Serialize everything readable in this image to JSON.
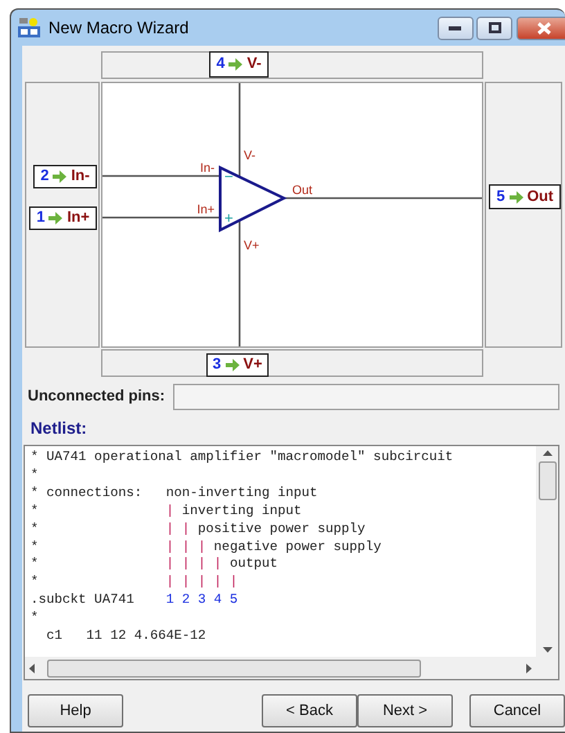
{
  "window": {
    "title": "New Macro Wizard"
  },
  "pins": [
    {
      "number": "4",
      "name": "V-",
      "kind": "top"
    },
    {
      "number": "2",
      "name": "In-",
      "kind": "inverting"
    },
    {
      "number": "1",
      "name": "In+",
      "kind": "noninverting"
    },
    {
      "number": "5",
      "name": "Out",
      "kind": "output"
    },
    {
      "number": "3",
      "name": "V+",
      "kind": "bottom"
    }
  ],
  "symbol": {
    "labels": [
      {
        "text": "V-",
        "kind": "top"
      },
      {
        "text": "In-",
        "kind": "inv"
      },
      {
        "text": "In+",
        "kind": "noninv"
      },
      {
        "text": "Out",
        "kind": "out"
      },
      {
        "text": "V+",
        "kind": "bottom"
      }
    ],
    "marks": [
      {
        "text": "−",
        "kind": "minus"
      },
      {
        "text": "+",
        "kind": "plus"
      }
    ]
  },
  "unconnected": {
    "label": "Unconnected pins:"
  },
  "netlist": {
    "label": "Netlist:",
    "lines": [
      [
        {
          "text": "* UA741 operational amplifier \"macromodel\" subcircuit",
          "kind": "plain"
        }
      ],
      [
        {
          "text": "*",
          "kind": "plain"
        }
      ],
      [
        {
          "text": "* connections:   non-inverting input",
          "kind": "plain"
        }
      ],
      [
        {
          "text": "*                ",
          "kind": "plain"
        },
        {
          "text": "|",
          "kind": "bar"
        },
        {
          "text": " inverting input",
          "kind": "plain"
        }
      ],
      [
        {
          "text": "*                ",
          "kind": "plain"
        },
        {
          "text": "| |",
          "kind": "bar"
        },
        {
          "text": " positive power supply",
          "kind": "plain"
        }
      ],
      [
        {
          "text": "*                ",
          "kind": "plain"
        },
        {
          "text": "| | |",
          "kind": "bar"
        },
        {
          "text": " negative power supply",
          "kind": "plain"
        }
      ],
      [
        {
          "text": "*                ",
          "kind": "plain"
        },
        {
          "text": "| | | |",
          "kind": "bar"
        },
        {
          "text": " output",
          "kind": "plain"
        }
      ],
      [
        {
          "text": "*                ",
          "kind": "plain"
        },
        {
          "text": "| | | | |",
          "kind": "bar"
        }
      ],
      [
        {
          "text": ".subckt UA741    ",
          "kind": "plain"
        },
        {
          "text": "1 2 3 4 5",
          "kind": "node"
        }
      ],
      [
        {
          "text": "*",
          "kind": "plain"
        }
      ],
      [
        {
          "text": "  c1   11 12 4.664E-12",
          "kind": "plain"
        }
      ]
    ]
  },
  "buttons": [
    {
      "label": "Help"
    },
    {
      "label": "< Back"
    },
    {
      "label": "Next >"
    },
    {
      "label": "Cancel"
    }
  ]
}
